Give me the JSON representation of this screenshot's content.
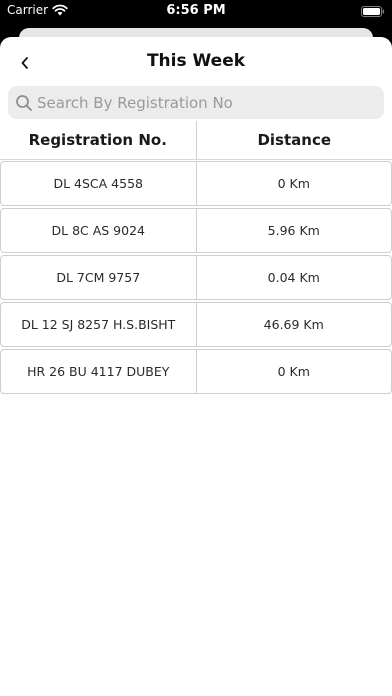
{
  "status_bar": {
    "carrier": "Carrier",
    "time": "6:56 PM"
  },
  "nav": {
    "title": "This Week",
    "back_icon": "chevron-left-icon"
  },
  "search": {
    "placeholder": "Search By Registration No",
    "value": ""
  },
  "table": {
    "columns": [
      "Registration No.",
      "Distance"
    ],
    "rows": [
      {
        "registration": "DL 4SCA 4558",
        "distance": "0 Km"
      },
      {
        "registration": "DL 8C AS 9024",
        "distance": "5.96 Km"
      },
      {
        "registration": "DL 7CM 9757",
        "distance": "0.04 Km"
      },
      {
        "registration": "DL 12 SJ 8257 H.S.BISHT",
        "distance": "46.69 Km"
      },
      {
        "registration": "HR 26 BU 4117 DUBEY",
        "distance": "0 Km"
      }
    ]
  }
}
